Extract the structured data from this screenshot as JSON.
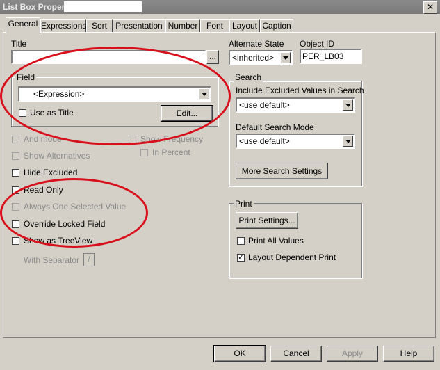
{
  "window": {
    "title": "List Box Propert",
    "close_glyph": "✕"
  },
  "tabs": [
    "General",
    "Expressions",
    "Sort",
    "Presentation",
    "Number",
    "Font",
    "Layout",
    "Caption"
  ],
  "general": {
    "title_label": "Title",
    "title_value": "",
    "title_button": "...",
    "alternate_state_label": "Alternate State",
    "alternate_state_value": "<inherited>",
    "object_id_label": "Object ID",
    "object_id_value": "PER_LB03",
    "field_group": "Field",
    "field_value": "<Expression>",
    "use_as_title": "Use as Title",
    "edit_button": "Edit...",
    "and_mode": "And mode",
    "show_frequency": "Show Frequency",
    "in_percent": "In Percent",
    "show_alternatives": "Show Alternatives",
    "hide_excluded": "Hide Excluded",
    "read_only": "Read Only",
    "always_one_selected": "Always One Selected Value",
    "override_locked": "Override Locked Field",
    "show_as_treeview": "Show as TreeView",
    "with_separator": "With Separator",
    "with_separator_value": "/"
  },
  "search": {
    "group": "Search",
    "include_excluded_label": "Include Excluded Values in Search",
    "include_excluded_value": "<use default>",
    "default_mode_label": "Default Search Mode",
    "default_mode_value": "<use default>",
    "more_settings_button": "More Search Settings"
  },
  "print": {
    "group": "Print",
    "settings_button": "Print Settings...",
    "print_all_values": "Print All Values",
    "layout_dependent": "Layout Dependent Print",
    "layout_dependent_checked": true
  },
  "footer": {
    "ok": "OK",
    "cancel": "Cancel",
    "apply": "Apply",
    "help": "Help"
  },
  "colors": {
    "annotation": "#d8101c",
    "dialog_bg": "#d4d0c8"
  }
}
